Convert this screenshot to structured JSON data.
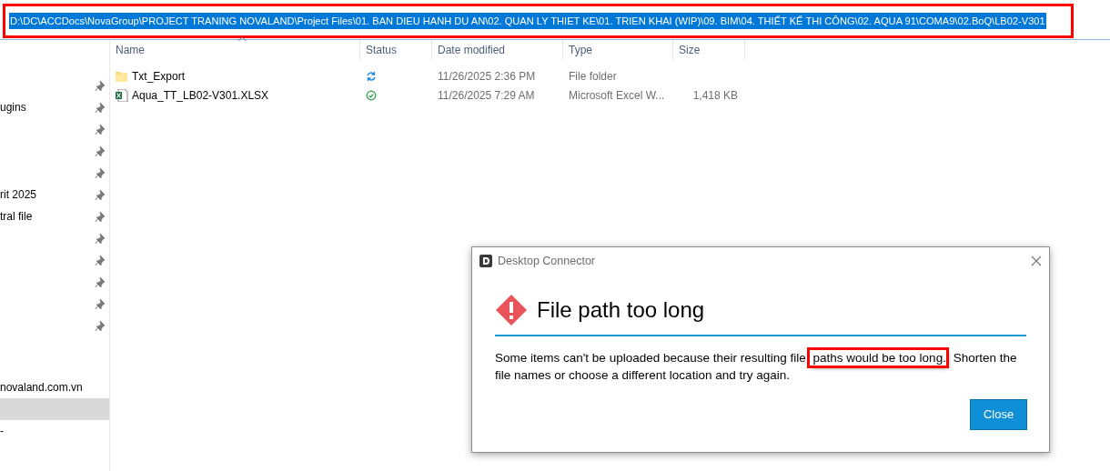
{
  "address_bar": {
    "value": "D:\\DC\\ACCDocs\\NovaGroup\\PROJECT TRANING NOVALAND\\Project Files\\01. BAN DIEU HANH DU AN\\02. QUAN LY THIET KE\\01. TRIEN KHAI (WIP)\\09. BIM\\04. THIẾT KẾ THI CÔNG\\02. AQUA 91\\COMA9\\02.BoQ\\LB02-V301",
    "selected": true,
    "highlighted": true
  },
  "sidebar": {
    "quick_access": [
      {
        "pinned": true
      },
      {
        "label": "ugins",
        "pinned": true
      },
      {
        "pinned": true
      },
      {
        "pinned": true
      },
      {
        "pinned": true
      },
      {
        "label": "rit 2025",
        "pinned": true
      },
      {
        "label": "tral file",
        "pinned": true
      },
      {
        "pinned": true
      },
      {
        "pinned": true
      },
      {
        "pinned": true
      },
      {
        "pinned": true
      },
      {
        "pinned": true
      }
    ],
    "items": [
      {
        "label": "novaland.com.vn",
        "selected": false
      },
      {
        "selected": true
      },
      {
        "label": "-",
        "selected": false
      }
    ]
  },
  "file_list": {
    "columns": [
      "Name",
      "Status",
      "Date modified",
      "Type",
      "Size"
    ],
    "rows": [
      {
        "kind": "folder",
        "name": "Txt_Export",
        "synced": false,
        "date_modified": "11/26/2025 2:36 PM",
        "type": "File folder"
      },
      {
        "kind": "excel",
        "name": "Aqua_TT_LB02-V301.XLSX",
        "synced": true,
        "date_modified": "11/26/2025 7:29 AM",
        "type": "Microsoft Excel W...",
        "size": "1,418 KB"
      }
    ]
  },
  "dialog": {
    "title": "Desktop Connector",
    "heading": "File path too long",
    "message_parts": [
      {
        "text": "Some items can't be uploaded because their resulting file",
        "highlighted": false
      },
      {
        "text": " paths would be too long.",
        "highlighted": true
      },
      {
        "text": " Shorten the file names or choose a different location and try again.",
        "highlighted": false
      }
    ],
    "button": "Close"
  }
}
